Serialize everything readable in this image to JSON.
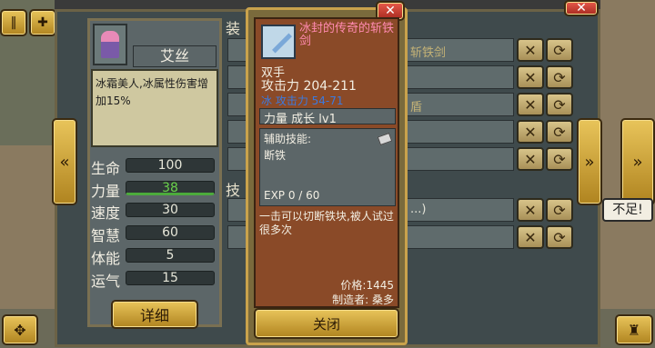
{
  "character": {
    "name": "艾丝",
    "description": "冰霜美人,冰属性伤害增加15%",
    "stats": [
      {
        "label": "生命",
        "value": "100"
      },
      {
        "label": "力量",
        "value": "38"
      },
      {
        "label": "速度",
        "value": "30"
      },
      {
        "label": "智慧",
        "value": "60"
      },
      {
        "label": "体能",
        "value": "5"
      },
      {
        "label": "运气",
        "value": "15"
      }
    ],
    "detail_button": "详细"
  },
  "tabs": {
    "equip_label": "装",
    "skill_label": "技"
  },
  "items": [
    {
      "name": "斩铁剑"
    },
    {
      "name": ""
    },
    {
      "name": "盾"
    },
    {
      "name": ""
    },
    {
      "name": ""
    }
  ],
  "skills": [
    {
      "name": "...)"
    },
    {
      "name": ""
    }
  ],
  "tooltip": {
    "title": "冰封的传奇的斩铁剑",
    "hand_type": "双手",
    "attack": "攻击力 204-211",
    "ice_attack": "冰 攻击力 54-71",
    "growth": "力量 成长 lv1",
    "support_skill_label": "辅助技能:",
    "support_skill_name": "断铁",
    "exp": "EXP 0 / 60",
    "flavor_text": "一击可以切断铁块,被人试过很多次",
    "price_label": "价格:1445",
    "maker_label": "制造者: 桑多",
    "close_button": "关闭"
  },
  "warning_text": "不足!",
  "colors": {
    "gold": "#e8c45a",
    "panel": "#4d5a5c",
    "tooltip_bg": "#8a4a28",
    "ice_blue": "#3a7ae0",
    "title_pink": "#ff8ab0",
    "green_stat": "#4caa3c"
  }
}
